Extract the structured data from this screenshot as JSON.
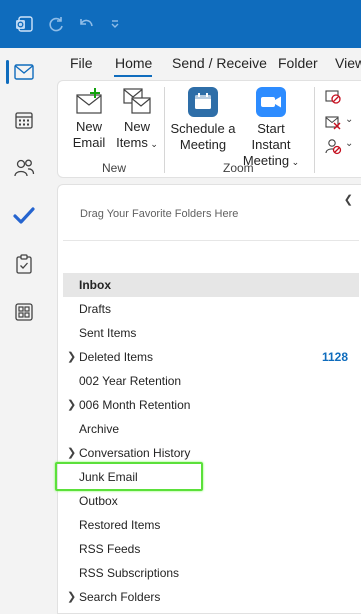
{
  "titlebar": {
    "icons": [
      "outlook-app-icon",
      "sync-icon",
      "undo-icon",
      "quick-access-dropdown-icon"
    ],
    "bg_color": "#0f6cbd"
  },
  "rail": {
    "items": [
      "mail-icon",
      "calendar-icon",
      "people-icon",
      "todo-icon",
      "tasks-icon",
      "apps-icon"
    ],
    "active": "mail-icon"
  },
  "tabs": [
    "File",
    "Home",
    "Send / Receive",
    "Folder",
    "View"
  ],
  "active_tab": "Home",
  "ribbon": {
    "new_email": [
      "New",
      "Email"
    ],
    "new_items": [
      "New",
      "Items"
    ],
    "group_new": "New",
    "schedule_meeting": [
      "Schedule a",
      "Meeting"
    ],
    "start_instant_meeting": [
      "Start Instant",
      "Meeting"
    ],
    "group_zoom": "Zoom"
  },
  "pane": {
    "favorites_placeholder": "Drag Your Favorite Folders Here",
    "collapse_icon": "chevron-left-icon"
  },
  "folders": [
    {
      "name": "Inbox",
      "selected": true
    },
    {
      "name": "Drafts"
    },
    {
      "name": "Sent Items"
    },
    {
      "name": "Deleted Items",
      "expandable": true,
      "count": "1128"
    },
    {
      "name": "002 Year Retention"
    },
    {
      "name": "006 Month Retention",
      "expandable": true
    },
    {
      "name": "Archive"
    },
    {
      "name": "Conversation History",
      "expandable": true
    },
    {
      "name": "Junk Email",
      "highlighted": true
    },
    {
      "name": "Outbox"
    },
    {
      "name": "Restored Items"
    },
    {
      "name": "RSS Feeds"
    },
    {
      "name": "RSS Subscriptions"
    },
    {
      "name": "Search Folders",
      "expandable": true
    }
  ],
  "colors": {
    "accent": "#0f6cbd",
    "highlight": "#5be03a",
    "selected_row": "#e6e6e6"
  }
}
